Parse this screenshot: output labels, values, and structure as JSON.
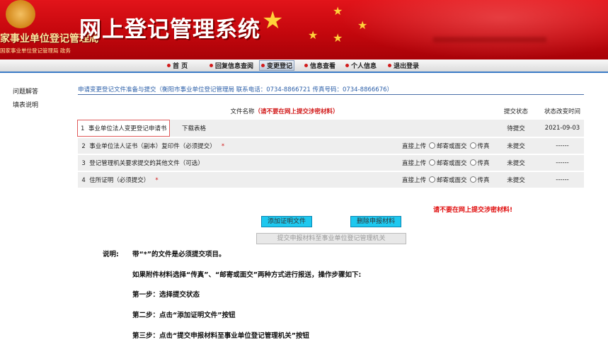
{
  "banner": {
    "title": "网上登记管理系统",
    "org_name": "家事业单位登记管理局",
    "org_sub": "国家事业单位登记管理局 政务"
  },
  "nav": {
    "items": [
      {
        "label": "首 页"
      },
      {
        "label": "回复信息查阅"
      },
      {
        "label": "变更登记"
      },
      {
        "label": "信息查看"
      },
      {
        "label": "个人信息"
      },
      {
        "label": "退出登录"
      }
    ],
    "active": "变更登记"
  },
  "sidebar": {
    "items": [
      {
        "label": "问题解答"
      },
      {
        "label": "填表说明"
      }
    ]
  },
  "page": {
    "breadcrumb": "申请变更登记文件准备与提交（衡阳市事业单位登记管理局 联系电话：0734-8866721 传真号码：0734-8866676）"
  },
  "table": {
    "header_name": "文件名称",
    "header_warning": "（请不要在网上提交涉密材料）",
    "header_status": "提交状态",
    "header_time": "状态改变时间",
    "rows": [
      {
        "num": "1",
        "name": "事业单位法人变更登记申请书",
        "extra": "下载表格",
        "status": "待提交",
        "time": "2021-09-03"
      },
      {
        "num": "2",
        "name": "事业单位法人证书（副本）复印件（必须提交）",
        "required_mark": "*",
        "status": "未提交",
        "time": "------"
      },
      {
        "num": "3",
        "name": "登记管理机关要求提交的其他文件（可选）",
        "status": "未提交",
        "time": "------"
      },
      {
        "num": "4",
        "name": "住所证明（必须提交）",
        "required_mark": "*",
        "status": "未提交",
        "time": "------"
      }
    ],
    "upload_direct": "直接上传",
    "upload_mail": "邮寄或面交",
    "upload_fax": "传真"
  },
  "warning": "请不要在网上提交涉密材料!",
  "buttons": {
    "add": "添加证明文件",
    "delete": "删除申报材料",
    "submit": "提交申报材料至事业单位登记管理机关"
  },
  "notes": {
    "label": "说明:",
    "line1": "带“*”的文件是必须提交项目。",
    "line2": "如果附件材料选择“传真”、“邮寄或面交”两种方式进行报送，操作步骤如下:",
    "step1": "第一步：选择提交状态",
    "step2": "第二步：点击“添加证明文件”按钮",
    "step3": "第三步：点击“提交申报材料至事业单位登记管理机关”按钮"
  },
  "colors": {
    "banner_red": "#c4070d",
    "accent_blue": "#2a5ea8",
    "button_cyan": "#1ec8ef",
    "warning_red": "#e01010"
  }
}
